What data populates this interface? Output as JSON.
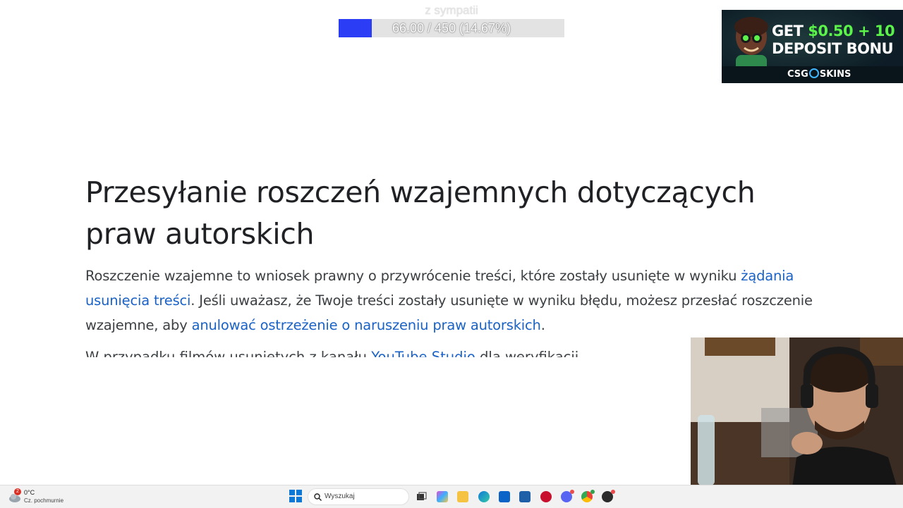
{
  "donation": {
    "label": "z sympatii",
    "progress_text": "66.00 / 450 (14.67%)",
    "progress_fraction": 0.1467,
    "fill_color": "#2b3df5"
  },
  "ad": {
    "headline_line1_prefix": "GET ",
    "headline_line1_amount": "$0.50 + 10",
    "headline_line2": "DEPOSIT BONU",
    "brand_left": "CSG",
    "brand_right": "SKINS",
    "accent_color": "#5bf24a"
  },
  "article": {
    "title": "Przesyłanie roszczeń wzajemnych dotyczących praw autorskich",
    "para_part1": "Roszczenie wzajemne to wniosek prawny o przywrócenie treści, które zostały usunięte w wyniku ",
    "para_link1": "żądania usunięcia treści",
    "para_part2": ". Jeśli uważasz, że Twoje treści zostały usunięte w wyniku błędu, możesz przesłać roszczenie wzajemne, aby ",
    "para_link2": "anulować ostrzeżenie o naruszeniu praw autorskich",
    "para_part3": ".",
    "cut_line_text": "W przypadku filmów usuniętych z kanału ",
    "cut_line_link": "YouTube Studio",
    "cut_line_rest": " dla weryfikacji",
    "link_color": "#1a62c5"
  },
  "taskbar": {
    "weather_temp": "0°C",
    "weather_desc": "Cz. pochmurnie",
    "weather_badge": "2",
    "search_placeholder": "Wyszukaj",
    "icons": [
      "task-view-icon",
      "copilot-icon",
      "file-explorer-icon",
      "edge-icon",
      "outlook-icon",
      "store-icon",
      "antivirus-icon",
      "discord-icon",
      "chrome-icon",
      "obs-icon"
    ]
  }
}
